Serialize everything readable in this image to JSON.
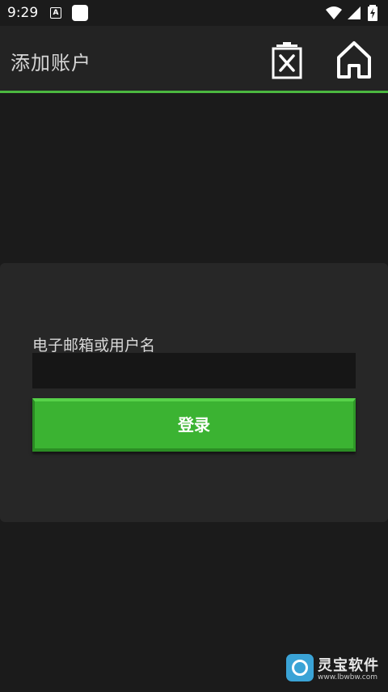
{
  "status_bar": {
    "time": "9:29",
    "a_icon_label": "A"
  },
  "app_bar": {
    "title": "添加账户",
    "delete_icon": "delete-x-icon",
    "home_icon": "home-icon"
  },
  "form": {
    "field_label": "电子邮箱或用户名",
    "input_value": "",
    "input_placeholder": "",
    "login_label": "登录"
  },
  "watermark": {
    "title": "灵宝软件",
    "url": "www.lbwbw.com"
  },
  "colors": {
    "background": "#1b1b1b",
    "app_bar": "#232323",
    "accent_line": "#4cb840",
    "card": "#272727",
    "input": "#161616",
    "login_button": "#3bb332"
  }
}
